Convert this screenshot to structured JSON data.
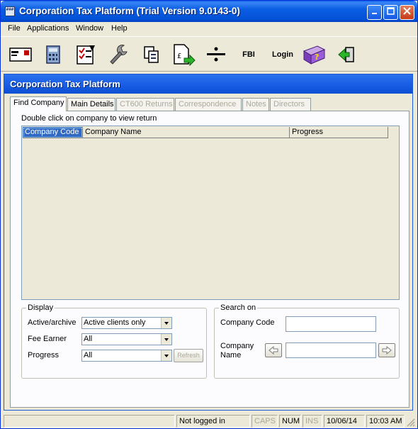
{
  "window": {
    "title": "Corporation Tax Platform (Trial Version 9.0143-0)",
    "app_icon_text": "###"
  },
  "menu": {
    "items": [
      "File",
      "Applications",
      "Window",
      "Help"
    ]
  },
  "toolbar": {
    "fbi_label": "FBI",
    "login_label": "Login"
  },
  "child": {
    "title": "Corporation Tax Platform",
    "tabs": [
      {
        "label": "Find Company",
        "state": "active"
      },
      {
        "label": "Main Details",
        "state": "enabled"
      },
      {
        "label": "CT600 Returns",
        "state": "disabled"
      },
      {
        "label": "Correspondence",
        "state": "disabled"
      },
      {
        "label": "Notes",
        "state": "disabled"
      },
      {
        "label": "Directors",
        "state": "disabled"
      }
    ],
    "hint": "Double click on company to view return",
    "list_columns": [
      "Company Code",
      "Company Name",
      "Progress"
    ],
    "display": {
      "legend": "Display",
      "active_label": "Active/archive",
      "active_value": "Active clients only",
      "fee_label": "Fee Earner",
      "fee_value": "All",
      "progress_label": "Progress",
      "progress_value": "All",
      "refresh_label": "Refresh"
    },
    "search": {
      "legend": "Search on",
      "code_label": "Company Code",
      "name_label_1": "Company",
      "name_label_2": "Name",
      "code_value": "",
      "name_value": ""
    }
  },
  "status": {
    "login": "Not logged in",
    "caps": "CAPS",
    "num": "NUM",
    "ins": "INS",
    "date": "10/06/14",
    "time": "10:03 AM"
  },
  "colors": {
    "titlebar": "#0a5ee2",
    "selection": "#316ac5",
    "background": "#ece9d8"
  }
}
